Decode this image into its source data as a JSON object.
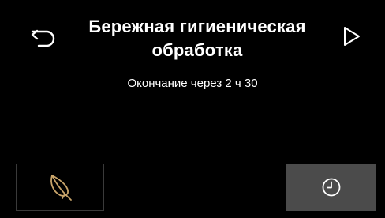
{
  "header": {
    "title": "Бережная гигиеническая обработка",
    "back_icon": "back-arrow-icon",
    "play_icon": "play-icon"
  },
  "status": {
    "end_text": "Окончание через 2 ч 30"
  },
  "options": {
    "feather_icon": "feather-icon",
    "accent_color": "#c8a46a"
  },
  "timer": {
    "clock_icon": "clock-icon",
    "button_color": "#4b4b4b"
  }
}
